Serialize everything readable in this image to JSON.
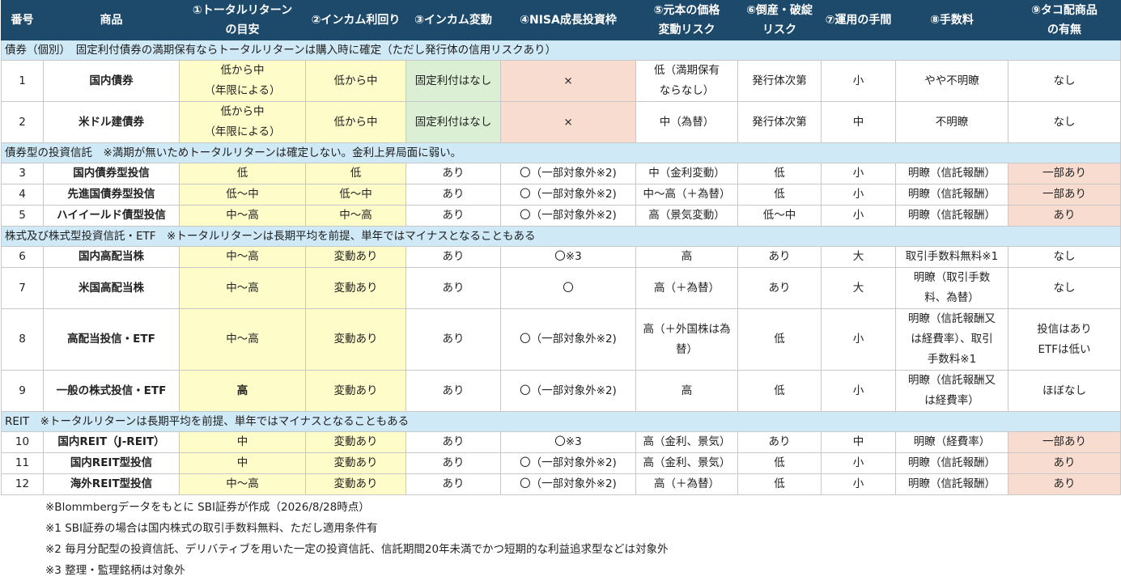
{
  "headers": [
    "番号",
    "商品",
    "①トータルリターン\nの目安",
    "②インカム利回り",
    "③インカム変動",
    "④NISA成長投資枠",
    "⑤元本の価格\n変動リスク",
    "⑥倒産・破綻\nリスク",
    "⑦運用の手間",
    "⑧手数料",
    "⑨タコ配商品\nの有無"
  ],
  "sections": [
    {
      "title": "債券（個別）　固定利付債券の満期保有ならトータルリターンは購入時に確定（ただし発行体の信用リスクあり）",
      "rows": [
        [
          "1",
          "国内債券",
          "低から中\n（年限による）",
          "低から中",
          "固定利付はなし",
          "×",
          "低（満期保有\nならなし）",
          "発行体次第",
          "小",
          "やや不明瞭",
          "なし"
        ],
        [
          "2",
          "米ドル建債券",
          "低から中\n（年限による）",
          "低から中",
          "固定利付はなし",
          "×",
          "中（為替）",
          "発行体次第",
          "中",
          "不明瞭",
          "なし"
        ]
      ]
    },
    {
      "title": "債券型の投資信託　※満期が無いためトータルリターンは確定しない。金利上昇局面に弱い。",
      "rows": [
        [
          "3",
          "国内債券型投信",
          "低",
          "低",
          "あり",
          "〇（一部対象外※2)",
          "中（金利変動）",
          "低",
          "小",
          "明瞭（信託報酬）",
          "一部あり"
        ],
        [
          "4",
          "先進国債券型投信",
          "低～中",
          "低～中",
          "あり",
          "〇（一部対象外※2)",
          "中～高（＋為替）",
          "低",
          "小",
          "明瞭（信託報酬）",
          "一部あり"
        ],
        [
          "5",
          "ハイイールド債型投信",
          "中～高",
          "中～高",
          "あり",
          "〇（一部対象外※2)",
          "高（景気変動）",
          "低～中",
          "小",
          "明瞭（信託報酬）",
          "あり"
        ]
      ]
    },
    {
      "title": "株式及び株式型投資信託・ETF　※トータルリターンは長期平均を前提、単年ではマイナスとなることもある",
      "rows": [
        [
          "6",
          "国内高配当株",
          "中～高",
          "変動あり",
          "あり",
          "〇※3",
          "高",
          "あり",
          "大",
          "取引手数料無料※1",
          "なし"
        ],
        [
          "7",
          "米国高配当株",
          "中～高",
          "変動あり",
          "あり",
          "〇",
          "高（＋為替）",
          "あり",
          "大",
          "明瞭（取引手数\n料、為替）",
          "なし"
        ],
        [
          "8",
          "高配当投信・ETF",
          "中～高",
          "変動あり",
          "あり",
          "〇（一部対象外※2)",
          "高（＋外国株は為\n替）",
          "低",
          "小",
          "明瞭（信託報酬又\nは経費率）、取引\n手数料※1",
          "投信はあり\nETFは低い"
        ],
        [
          "9",
          "一般の株式投信・ETF",
          "高",
          "変動あり",
          "あり",
          "〇（一部対象外※2)",
          "高",
          "低",
          "小",
          "明瞭（信託報酬又\nは経費率）",
          "ほぼなし"
        ]
      ]
    },
    {
      "title": "REIT　※トータルリターンは長期平均を前提、単年ではマイナスとなることもある",
      "rows": [
        [
          "10",
          "国内REIT（J-REIT）",
          "中",
          "変動あり",
          "あり",
          "〇※3",
          "高（金利、景気）",
          "あり",
          "中",
          "明瞭（経費率）",
          "一部あり"
        ],
        [
          "11",
          "国内REIT型投信",
          "中",
          "変動あり",
          "あり",
          "〇（一部対象外※2)",
          "高（金利、景気）",
          "低",
          "小",
          "明瞭（信託報酬）",
          "あり"
        ],
        [
          "12",
          "海外REIT型投信",
          "中～高",
          "変動あり",
          "あり",
          "〇（一部対象外※2)",
          "高（＋為替）",
          "低",
          "小",
          "明瞭（信託報酬）",
          "あり"
        ]
      ]
    }
  ],
  "notes": [
    "※Blommbergデータをもとに SBI証券が作成（2026/8/28時点）",
    "※1 SBI証券の場合は国内株式の取引手数料無料、ただし適用条件有",
    "※2 毎月分配型の投資信託、デリバティブを用いた一定の投資信託、信託期間20年未満でかつ短期的な利益追求型などは対象外",
    "※3 整理・監理銘柄は対象外"
  ],
  "colors": {
    "header_bg": "#1d4a6b",
    "section_bg": "#cfe9f6",
    "return_bg": "#fefcc8",
    "green_bg": "#daefd3",
    "pink_bg": "#f8dcd0"
  }
}
